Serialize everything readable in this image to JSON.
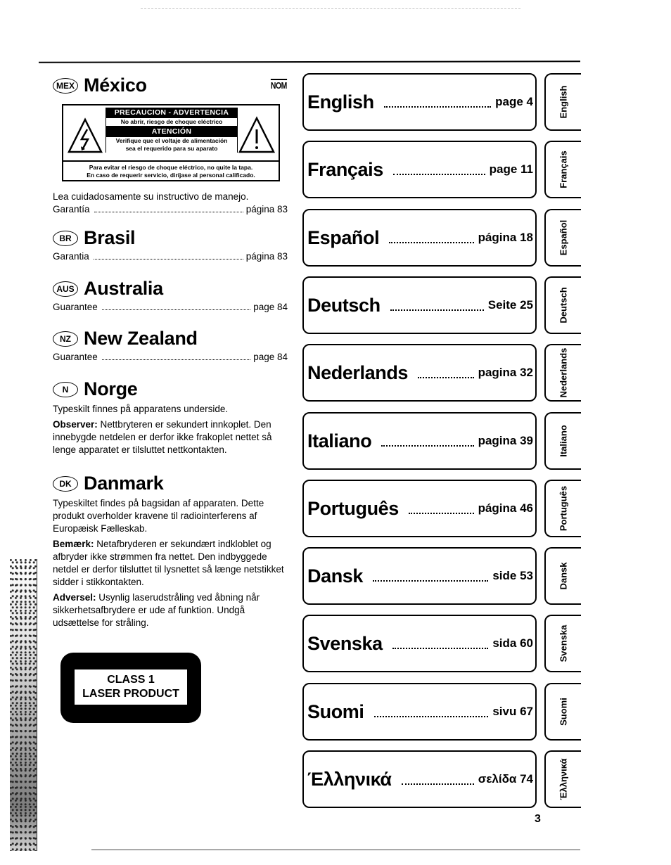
{
  "page": {
    "page_number": "3"
  },
  "nom_mark": "NOM",
  "mexico": {
    "badge": "MEX",
    "title": "México",
    "warning": {
      "header": "PRECAUCION - ADVERTENCIA",
      "line1": "No abrir, riesgo de choque eléctrico",
      "attention": "ATENCIÓN",
      "line2": "Verifique que el voltaje de alimentación",
      "line3": "sea el requerido para su aparato",
      "bottom1": "Para evitar el riesgo de choque eléctrico, no quite la tapa.",
      "bottom2": "En caso de requerir servicio, diríjase al personal calificado."
    },
    "text": "Lea cuidadosamente su instructivo de manejo.",
    "guarantee_label": "Garantía",
    "guarantee_page": "página 83"
  },
  "brasil": {
    "badge": "BR",
    "title": "Brasil",
    "guarantee_label": "Garantia",
    "guarantee_page": "página 83"
  },
  "australia": {
    "badge": "AUS",
    "title": "Australia",
    "guarantee_label": "Guarantee",
    "guarantee_page": "page 84"
  },
  "new_zealand": {
    "badge": "NZ",
    "title": "New Zealand",
    "guarantee_label": "Guarantee",
    "guarantee_page": "page 84"
  },
  "norge": {
    "badge": "N",
    "title": "Norge",
    "text1": "Typeskilt finnes på apparatens underside.",
    "observer_label": "Observer:",
    "observer_text": " Nettbryteren er sekundert innkoplet. Den innebygde netdelen er derfor ikke frakoplet nettet så lenge apparatet er tilsluttet nettkontakten."
  },
  "danmark": {
    "badge": "DK",
    "title": "Danmark",
    "text1": "Typeskiltet findes på bagsidan af apparaten. Dette produkt overholder kravene til radiointerferens af Europæisk Fælleskab.",
    "bemaerk_label": "Bemærk:",
    "bemaerk_text": " Netafbryderen er sekundært indkloblet og afbryder ikke strømmen fra nettet. Den indbyggede netdel er derfor tilsluttet til lysnettet så længe netstikket sidder i stikkontakten.",
    "adversel_label": "Adversel:",
    "adversel_text": " Usynlig laserudstråling ved åbning når sikkerhetsafbrydere er ude af funktion. Undgå udsættelse for stråling."
  },
  "laser_label": {
    "line1": "CLASS 1",
    "line2": "LASER PRODUCT"
  },
  "languages": [
    {
      "name": "English",
      "page": "page 4",
      "tab": "English"
    },
    {
      "name": "Français",
      "page": "page 11",
      "tab": "Français"
    },
    {
      "name": "Español",
      "page": "página 18",
      "tab": "Español"
    },
    {
      "name": "Deutsch",
      "page": "Seite 25",
      "tab": "Deutsch"
    },
    {
      "name": "Nederlands",
      "page": "pagina 32",
      "tab": "Nederlands"
    },
    {
      "name": "Italiano",
      "page": "pagina 39",
      "tab": "Italiano"
    },
    {
      "name": "Português",
      "page": "página 46",
      "tab": "Português"
    },
    {
      "name": "Dansk",
      "page": "side 53",
      "tab": "Dansk"
    },
    {
      "name": "Svenska",
      "page": "sida 60",
      "tab": "Svenska"
    },
    {
      "name": "Suomi",
      "page": "sivu 67",
      "tab": "Suomi"
    },
    {
      "name": "Έλληνικά",
      "page": "σελίδα 74",
      "tab": "Έλληνικά"
    }
  ]
}
